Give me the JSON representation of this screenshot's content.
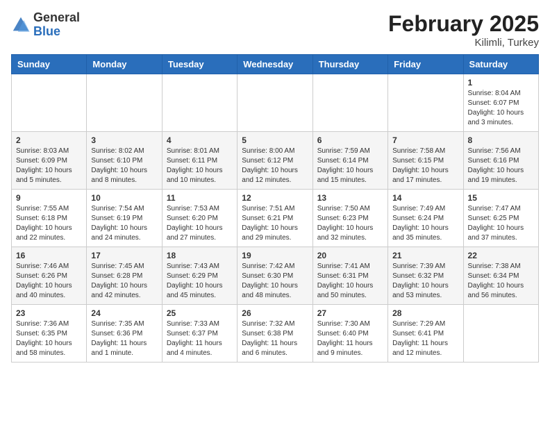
{
  "header": {
    "logo_general": "General",
    "logo_blue": "Blue",
    "month_year": "February 2025",
    "location": "Kilimli, Turkey"
  },
  "weekdays": [
    "Sunday",
    "Monday",
    "Tuesday",
    "Wednesday",
    "Thursday",
    "Friday",
    "Saturday"
  ],
  "weeks": [
    [
      {
        "day": "",
        "info": ""
      },
      {
        "day": "",
        "info": ""
      },
      {
        "day": "",
        "info": ""
      },
      {
        "day": "",
        "info": ""
      },
      {
        "day": "",
        "info": ""
      },
      {
        "day": "",
        "info": ""
      },
      {
        "day": "1",
        "info": "Sunrise: 8:04 AM\nSunset: 6:07 PM\nDaylight: 10 hours\nand 3 minutes."
      }
    ],
    [
      {
        "day": "2",
        "info": "Sunrise: 8:03 AM\nSunset: 6:09 PM\nDaylight: 10 hours\nand 5 minutes."
      },
      {
        "day": "3",
        "info": "Sunrise: 8:02 AM\nSunset: 6:10 PM\nDaylight: 10 hours\nand 8 minutes."
      },
      {
        "day": "4",
        "info": "Sunrise: 8:01 AM\nSunset: 6:11 PM\nDaylight: 10 hours\nand 10 minutes."
      },
      {
        "day": "5",
        "info": "Sunrise: 8:00 AM\nSunset: 6:12 PM\nDaylight: 10 hours\nand 12 minutes."
      },
      {
        "day": "6",
        "info": "Sunrise: 7:59 AM\nSunset: 6:14 PM\nDaylight: 10 hours\nand 15 minutes."
      },
      {
        "day": "7",
        "info": "Sunrise: 7:58 AM\nSunset: 6:15 PM\nDaylight: 10 hours\nand 17 minutes."
      },
      {
        "day": "8",
        "info": "Sunrise: 7:56 AM\nSunset: 6:16 PM\nDaylight: 10 hours\nand 19 minutes."
      }
    ],
    [
      {
        "day": "9",
        "info": "Sunrise: 7:55 AM\nSunset: 6:18 PM\nDaylight: 10 hours\nand 22 minutes."
      },
      {
        "day": "10",
        "info": "Sunrise: 7:54 AM\nSunset: 6:19 PM\nDaylight: 10 hours\nand 24 minutes."
      },
      {
        "day": "11",
        "info": "Sunrise: 7:53 AM\nSunset: 6:20 PM\nDaylight: 10 hours\nand 27 minutes."
      },
      {
        "day": "12",
        "info": "Sunrise: 7:51 AM\nSunset: 6:21 PM\nDaylight: 10 hours\nand 29 minutes."
      },
      {
        "day": "13",
        "info": "Sunrise: 7:50 AM\nSunset: 6:23 PM\nDaylight: 10 hours\nand 32 minutes."
      },
      {
        "day": "14",
        "info": "Sunrise: 7:49 AM\nSunset: 6:24 PM\nDaylight: 10 hours\nand 35 minutes."
      },
      {
        "day": "15",
        "info": "Sunrise: 7:47 AM\nSunset: 6:25 PM\nDaylight: 10 hours\nand 37 minutes."
      }
    ],
    [
      {
        "day": "16",
        "info": "Sunrise: 7:46 AM\nSunset: 6:26 PM\nDaylight: 10 hours\nand 40 minutes."
      },
      {
        "day": "17",
        "info": "Sunrise: 7:45 AM\nSunset: 6:28 PM\nDaylight: 10 hours\nand 42 minutes."
      },
      {
        "day": "18",
        "info": "Sunrise: 7:43 AM\nSunset: 6:29 PM\nDaylight: 10 hours\nand 45 minutes."
      },
      {
        "day": "19",
        "info": "Sunrise: 7:42 AM\nSunset: 6:30 PM\nDaylight: 10 hours\nand 48 minutes."
      },
      {
        "day": "20",
        "info": "Sunrise: 7:41 AM\nSunset: 6:31 PM\nDaylight: 10 hours\nand 50 minutes."
      },
      {
        "day": "21",
        "info": "Sunrise: 7:39 AM\nSunset: 6:32 PM\nDaylight: 10 hours\nand 53 minutes."
      },
      {
        "day": "22",
        "info": "Sunrise: 7:38 AM\nSunset: 6:34 PM\nDaylight: 10 hours\nand 56 minutes."
      }
    ],
    [
      {
        "day": "23",
        "info": "Sunrise: 7:36 AM\nSunset: 6:35 PM\nDaylight: 10 hours\nand 58 minutes."
      },
      {
        "day": "24",
        "info": "Sunrise: 7:35 AM\nSunset: 6:36 PM\nDaylight: 11 hours\nand 1 minute."
      },
      {
        "day": "25",
        "info": "Sunrise: 7:33 AM\nSunset: 6:37 PM\nDaylight: 11 hours\nand 4 minutes."
      },
      {
        "day": "26",
        "info": "Sunrise: 7:32 AM\nSunset: 6:38 PM\nDaylight: 11 hours\nand 6 minutes."
      },
      {
        "day": "27",
        "info": "Sunrise: 7:30 AM\nSunset: 6:40 PM\nDaylight: 11 hours\nand 9 minutes."
      },
      {
        "day": "28",
        "info": "Sunrise: 7:29 AM\nSunset: 6:41 PM\nDaylight: 11 hours\nand 12 minutes."
      },
      {
        "day": "",
        "info": ""
      }
    ]
  ]
}
